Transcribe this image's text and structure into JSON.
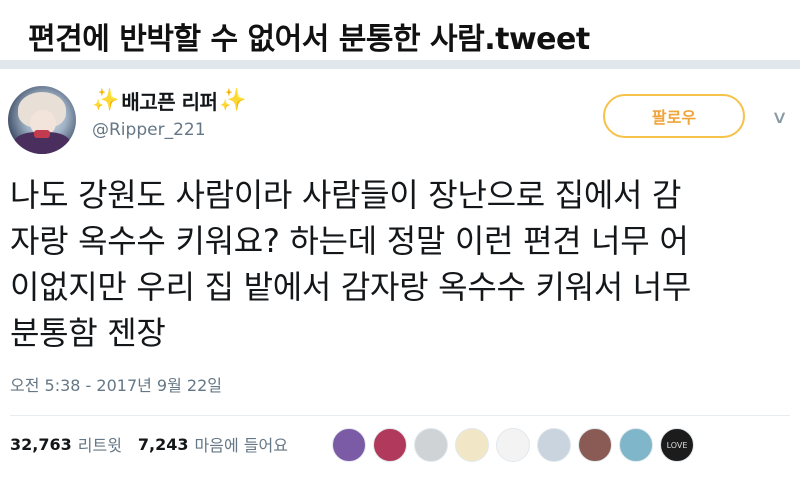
{
  "post_title": "편견에 반박할 수 없어서 분통한 사람.tweet",
  "user": {
    "sparkle_left": "✨",
    "display_name": "배고픈 리퍼",
    "sparkle_right": "✨",
    "handle": "@Ripper_221"
  },
  "follow_button": "팔로우",
  "menu_chevron": "∨",
  "tweet_lines": [
    "나도 강원도 사람이라 사람들이 장난으로 집에서 감",
    "자랑 옥수수 키워요? 하는데 정말 이런 편견 너무 어",
    "이없지만 우리 집 밭에서 감자랑 옥수수 키워서 너무",
    "분통함 젠장"
  ],
  "timestamp": "오전 5:38 - 2017년 9월 22일",
  "stats": {
    "retweets_count": "32,763",
    "retweets_label": "리트윗",
    "likes_count": "7,243",
    "likes_label": "마음에 들어요"
  },
  "liker_avatars": [
    {
      "color": "#7b5aa6",
      "label": ""
    },
    {
      "color": "#b13a5c",
      "label": ""
    },
    {
      "color": "#cfd3d6",
      "label": ""
    },
    {
      "color": "#f1e7c7",
      "label": ""
    },
    {
      "color": "#f3f3f3",
      "label": ""
    },
    {
      "color": "#c9d4de",
      "label": ""
    },
    {
      "color": "#8a5a54",
      "label": ""
    },
    {
      "color": "#7fb6c9",
      "label": ""
    },
    {
      "color": "#1c1c1c",
      "label": "LOVE"
    }
  ],
  "colors": {
    "follow_accent": "#f5c24a",
    "secondary_text": "#657786"
  }
}
